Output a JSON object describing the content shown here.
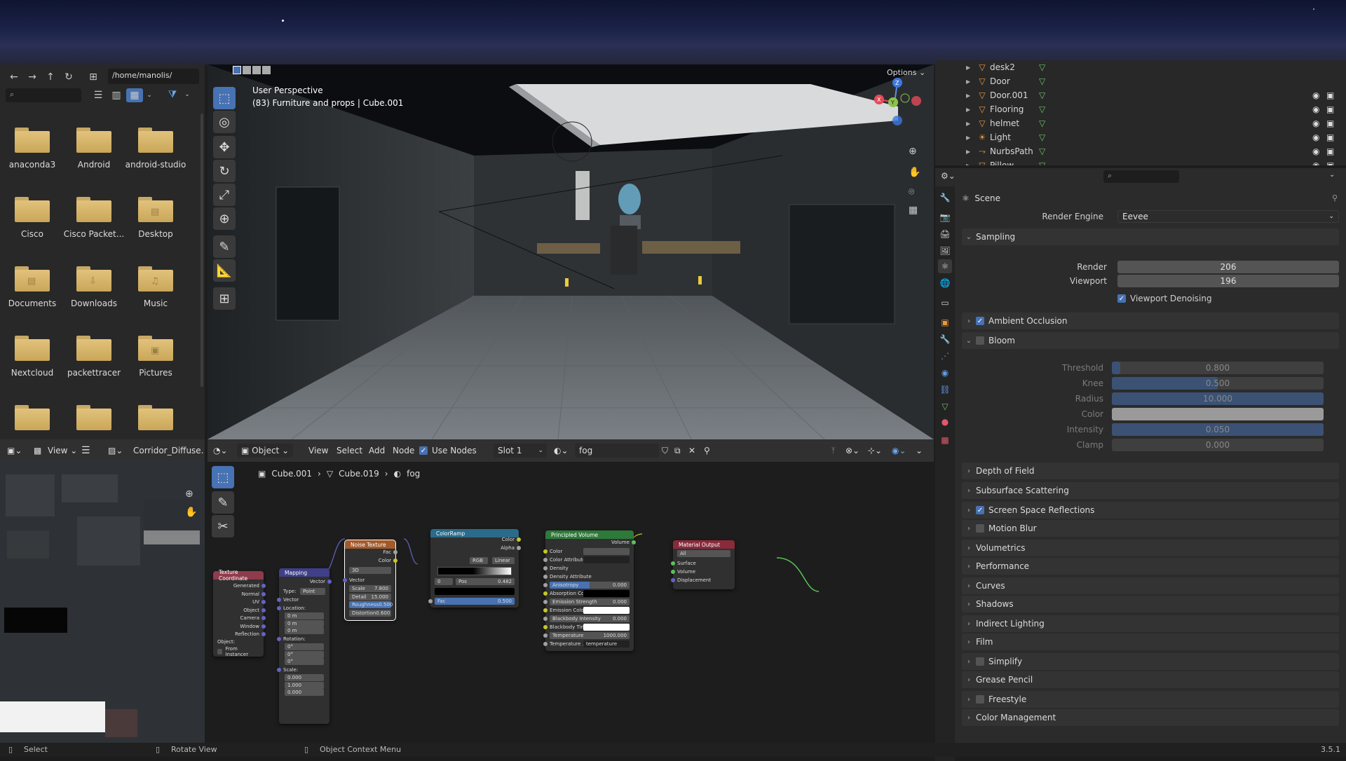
{
  "file_browser": {
    "path": "/home/manolis/",
    "search_placeholder": "",
    "folders": [
      {
        "label": "anaconda3",
        "icon": ""
      },
      {
        "label": "Android",
        "icon": ""
      },
      {
        "label": "android-studio",
        "icon": ""
      },
      {
        "label": "Cisco",
        "icon": ""
      },
      {
        "label": "Cisco Packet...",
        "icon": ""
      },
      {
        "label": "Desktop",
        "icon": "▤"
      },
      {
        "label": "Documents",
        "icon": "▤"
      },
      {
        "label": "Downloads",
        "icon": "⇩"
      },
      {
        "label": "Music",
        "icon": "♫"
      },
      {
        "label": "Nextcloud",
        "icon": ""
      },
      {
        "label": "packettracer",
        "icon": ""
      },
      {
        "label": "Pictures",
        "icon": "▣"
      },
      {
        "label": "",
        "icon": ""
      },
      {
        "label": "",
        "icon": ""
      },
      {
        "label": "",
        "icon": ""
      }
    ]
  },
  "viewport": {
    "options_label": "Options",
    "perspective_label": "User Perspective",
    "object_info": "(83) Furniture and props | Cube.001",
    "gizmo_axes": {
      "x": "X",
      "y": "Y",
      "z": "Z"
    }
  },
  "outliner": {
    "items": [
      {
        "name": "desk2"
      },
      {
        "name": "Door"
      },
      {
        "name": "Door.001"
      },
      {
        "name": "Flooring"
      },
      {
        "name": "helmet"
      },
      {
        "name": "Light"
      },
      {
        "name": "NurbsPath"
      },
      {
        "name": "Pillow"
      }
    ]
  },
  "properties": {
    "scene_label": "Scene",
    "render_engine_label": "Render Engine",
    "render_engine_value": "Eevee",
    "sampling": {
      "title": "Sampling",
      "render_label": "Render",
      "render_value": "206",
      "viewport_label": "Viewport",
      "viewport_value": "196",
      "denoise_label": "Viewport Denoising"
    },
    "ambient_occlusion": "Ambient Occlusion",
    "bloom": {
      "title": "Bloom",
      "threshold_label": "Threshold",
      "threshold_value": "0.800",
      "threshold_fill": 0.04,
      "knee_label": "Knee",
      "knee_value": "0.500",
      "knee_fill": 0.5,
      "radius_label": "Radius",
      "radius_value": "10.000",
      "radius_fill": 1.0,
      "color_label": "Color",
      "intensity_label": "Intensity",
      "intensity_value": "0.050",
      "intensity_fill": 1.0,
      "clamp_label": "Clamp",
      "clamp_value": "0.000"
    },
    "panels": [
      "Depth of Field",
      "Subsurface Scattering",
      "Screen Space Reflections",
      "Motion Blur",
      "Volumetrics",
      "Performance",
      "Curves",
      "Shadows",
      "Indirect Lighting",
      "Film",
      "Simplify",
      "Grease Pencil",
      "Freestyle",
      "Color Management"
    ]
  },
  "image_editor": {
    "view_label": "View",
    "image_name": "Corridor_Diffuse.dds"
  },
  "node_editor": {
    "mode": "Object",
    "menu_view": "View",
    "menu_select": "Select",
    "menu_add": "Add",
    "menu_node": "Node",
    "use_nodes_label": "Use Nodes",
    "slot": "Slot 1",
    "material": "fog",
    "breadcrumb": {
      "object": "Cube.001",
      "mesh": "Cube.019",
      "material": "fog"
    },
    "nodes": {
      "texcoord": {
        "title": "Texture Coordinate",
        "outputs": [
          "Generated",
          "Normal",
          "UV",
          "Object",
          "Camera",
          "Window",
          "Reflection"
        ],
        "object_label": "Object:",
        "instancer": "From Instancer"
      },
      "mapping": {
        "title": "Mapping",
        "vector": "Vector",
        "type_label": "Type:",
        "type_value": "Point",
        "vector_in": "Vector",
        "location": "Location:",
        "rotation": "Rotation:",
        "scale": "Scale:",
        "loc": [
          "0 m",
          "0 m",
          "0 m"
        ],
        "rot": [
          "0°",
          "0°",
          "0°"
        ],
        "scl": [
          "0.000",
          "1.000",
          "0.000"
        ],
        "axes": [
          "X",
          "Y",
          "Z"
        ]
      },
      "noise": {
        "title": "Noise Texture",
        "fac": "Fac",
        "color": "Color",
        "dim": "3D",
        "vector": "Vector",
        "scale_label": "Scale",
        "scale": "7.800",
        "detail_label": "Detail",
        "detail": "15.000",
        "rough_label": "Roughness",
        "rough": "0.500",
        "dist_label": "Distortion",
        "dist": "0.600"
      },
      "ramp": {
        "title": "ColorRamp",
        "color": "Color",
        "alpha": "Alpha",
        "mode": "RGB",
        "interp": "Linear",
        "stop": "0",
        "pos_label": "Pos",
        "pos": "0.482",
        "fac_label": "Fac",
        "fac": "0.500"
      },
      "volume": {
        "title": "Principled Volume",
        "out": "Volume",
        "rows": [
          "Color",
          "Color Attribute",
          "Density",
          "Density Attribute"
        ],
        "aniso_label": "Anisotropy",
        "aniso": "0.000",
        "absorb": "Absorption Color",
        "emit_str_label": "Emission Strength",
        "emit_str": "0.000",
        "emit_col": "Emission Color",
        "bb_int_label": "Blackbody Intensity",
        "bb_int": "0.000",
        "bb_tint": "Blackbody Tint",
        "temp_label": "Temperature",
        "temp": "1000.000",
        "tattr_label": "Temperature ...",
        "tattr": "temperature"
      },
      "output": {
        "title": "Material Output",
        "target": "All",
        "surface": "Surface",
        "volume": "Volume",
        "displacement": "Displacement"
      }
    }
  },
  "status": {
    "select": "Select",
    "rotate": "Rotate View",
    "context": "Object Context Menu",
    "version": "3.5.1"
  },
  "colors": {
    "accent": "#4772b3",
    "panel": "#2b2b2b",
    "header": "#303030"
  }
}
